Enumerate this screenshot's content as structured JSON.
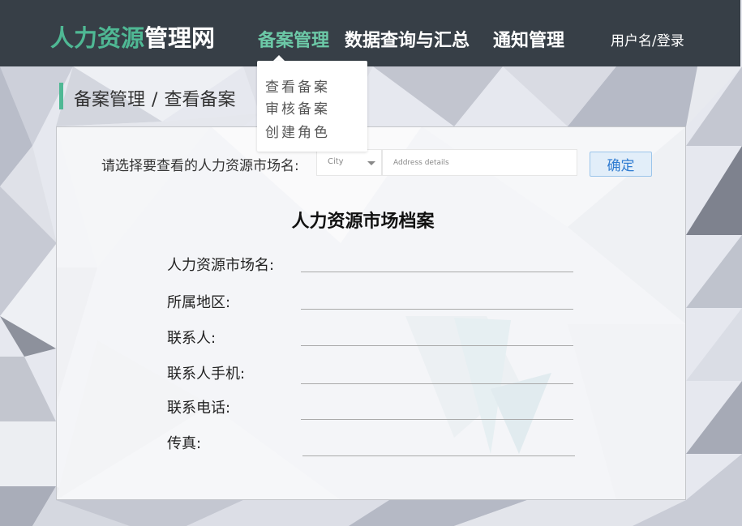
{
  "header": {
    "logo_part1": "人力资源",
    "logo_part2": "管理网",
    "nav": {
      "filing": "备案管理",
      "query": "数据查询与汇总",
      "notice": "通知管理"
    },
    "user": "用户名/登录"
  },
  "dropdown": {
    "items": [
      "查看备案",
      "审核备案",
      "创建角色"
    ]
  },
  "breadcrumb": {
    "section": "备案管理",
    "separator": "/",
    "page": "查看备案"
  },
  "search": {
    "label": "请选择要查看的人力资源市场名:",
    "city_placeholder": "City",
    "address_placeholder": "Address details",
    "confirm_label": "确定"
  },
  "archive": {
    "title": "人力资源市场档案",
    "fields": [
      "人力资源市场名:",
      "所属地区:",
      "联系人:",
      "联系人手机:",
      "联系电话:",
      "传真:"
    ]
  },
  "colors": {
    "header_bg": "#373f47",
    "accent_green": "#4fb894",
    "button_blue": "#2e7bd1"
  }
}
